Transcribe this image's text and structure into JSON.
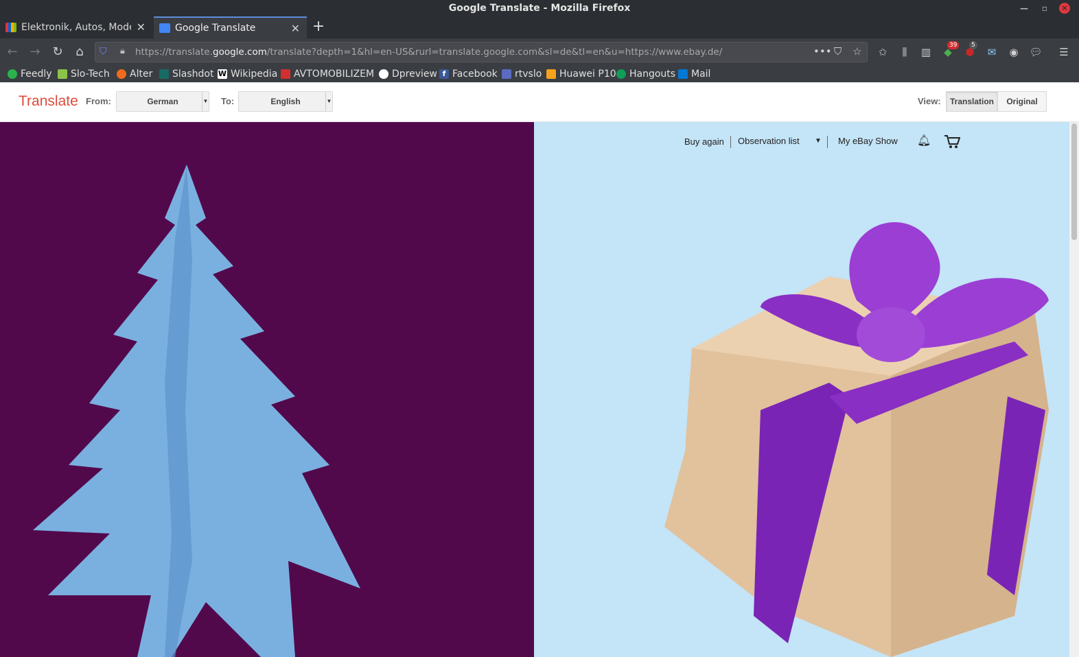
{
  "window": {
    "title": "Google Translate - Mozilla Firefox"
  },
  "tabs": [
    {
      "label": "Elektronik, Autos, Mode, Sammeln",
      "active": false
    },
    {
      "label": "Google Translate",
      "active": true
    }
  ],
  "urlbar": {
    "prefix": "https://translate.",
    "domain": "google.com",
    "suffix": "/translate?depth=1&hl=en-US&rurl=translate.google.com&sl=de&tl=en&u=https://www.ebay.de/"
  },
  "toolbar": {
    "badge_counts": [
      "39",
      "5"
    ]
  },
  "bookmarks": [
    {
      "label": "Feedly",
      "color": "#2bb24c"
    },
    {
      "label": "Slo-Tech",
      "color": "#8bc34a"
    },
    {
      "label": "Alter",
      "color": "#f06b1c"
    },
    {
      "label": "Slashdot",
      "color": "#1a6a64"
    },
    {
      "label": "Wikipedia",
      "color": "#ffffff"
    },
    {
      "label": "AVTOMOBILIZEM",
      "color": "#d32f2f"
    },
    {
      "label": "Dpreview",
      "color": "#ffffff"
    },
    {
      "label": "Facebook",
      "color": "#3b5998"
    },
    {
      "label": "rtvslo",
      "color": "#5c6bc0"
    },
    {
      "label": "Huawei P10",
      "color": "#f7a21b"
    },
    {
      "label": "Hangouts",
      "color": "#0f9d58"
    },
    {
      "label": "Mail",
      "color": "#0078d4"
    }
  ],
  "translate": {
    "brand": "Translate",
    "from_label": "From:",
    "from_value": "German",
    "to_label": "To:",
    "to_value": "English",
    "view_label": "View:",
    "view_translation": "Translation",
    "view_original": "Original"
  },
  "ebay": {
    "buy_again": "Buy again",
    "observation_list": "Observation list",
    "my_ebay": "My eBay Show"
  },
  "colors": {
    "left_panel": "#52094c",
    "right_panel": "#c4e4f7",
    "brand": "#dd4b39"
  }
}
